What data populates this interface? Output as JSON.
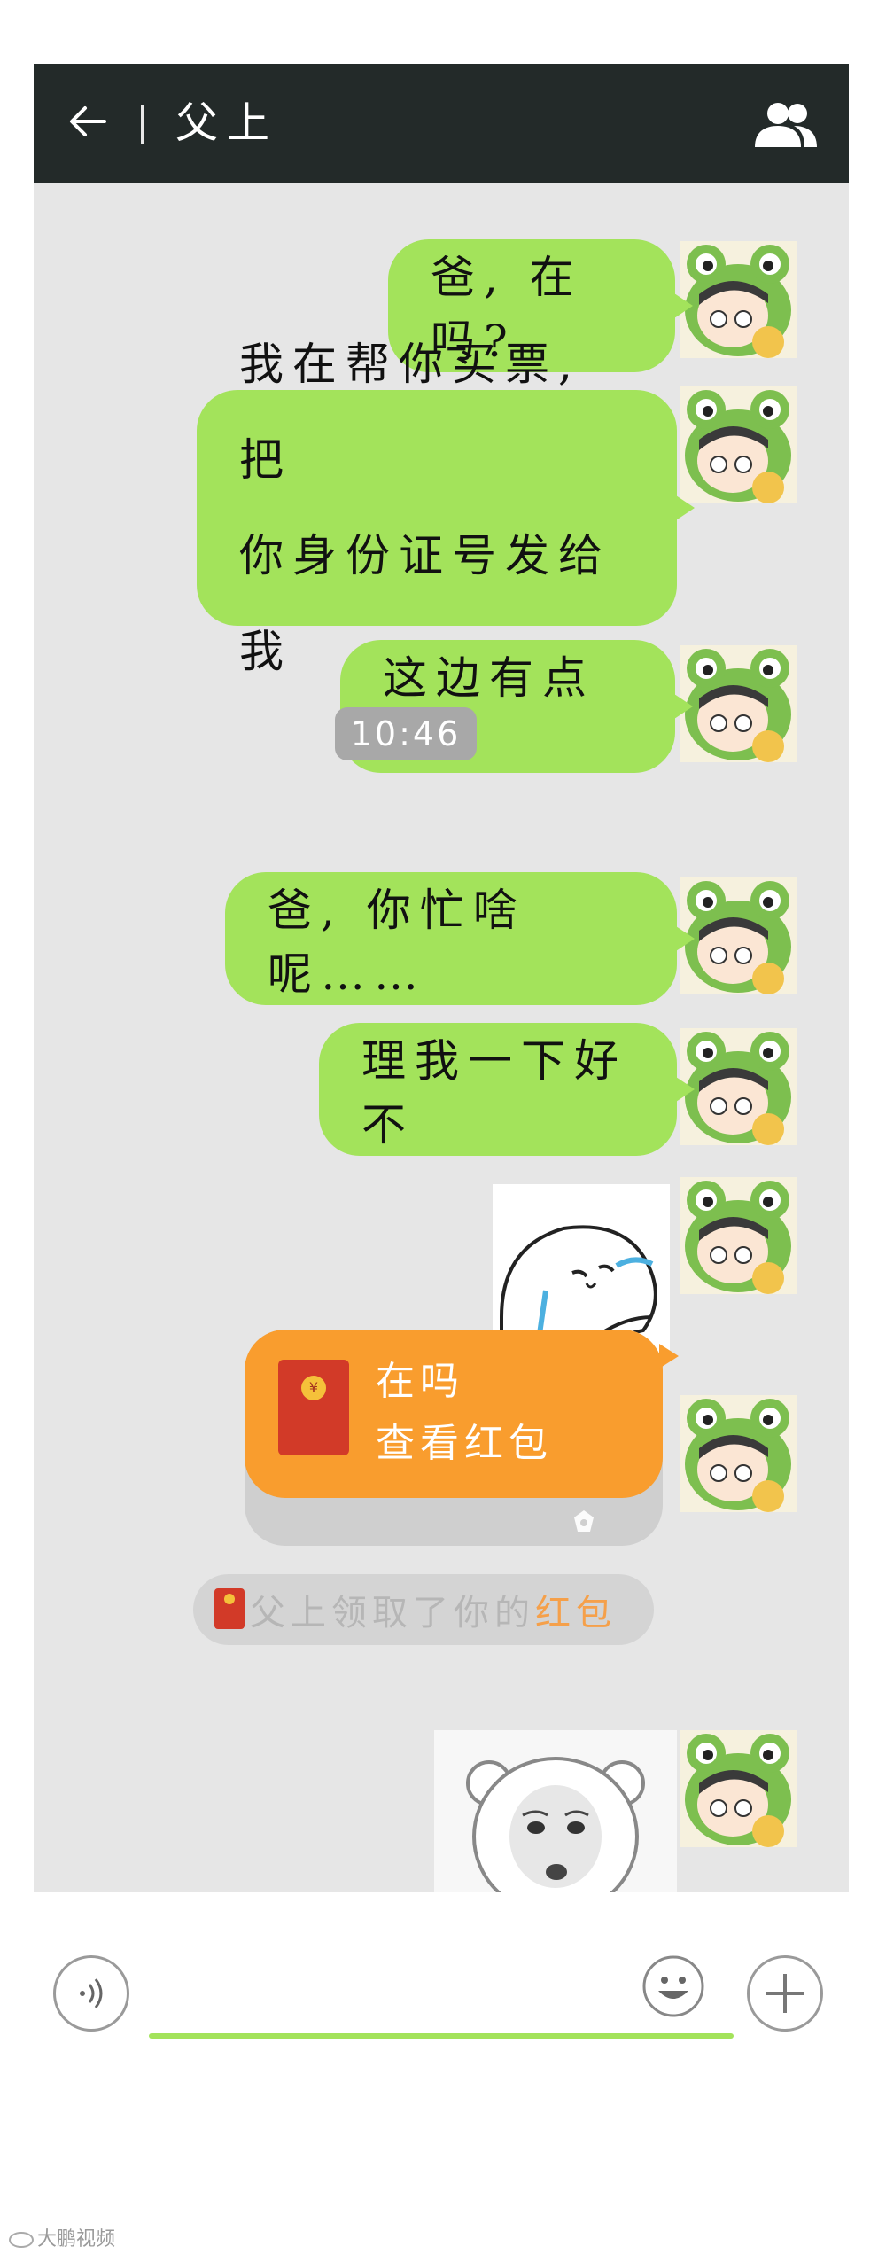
{
  "header": {
    "title": "父上",
    "back_icon": "arrow-left-icon",
    "contacts_icon": "group-icon"
  },
  "messages": [
    {
      "type": "text",
      "lines": [
        "爸, 在吗?"
      ]
    },
    {
      "type": "text",
      "lines": [
        "我在帮你买票, 把",
        "你身份证号发给我"
      ]
    },
    {
      "type": "text",
      "lines": [
        "这边有点急"
      ]
    },
    {
      "type": "time",
      "text": "10:46"
    },
    {
      "type": "text",
      "lines": [
        "爸, 你忙啥呢……"
      ]
    },
    {
      "type": "text",
      "lines": [
        "理我一下好不"
      ]
    },
    {
      "type": "sticker",
      "description": "crying-bun-sticker"
    },
    {
      "type": "red_packet",
      "title": "在吗",
      "subtitle": "查看红包"
    },
    {
      "type": "notice",
      "prefix": "父上领取了你的",
      "highlight": "红包"
    },
    {
      "type": "sticker",
      "description": "shocked-bear-sticker"
    }
  ],
  "input": {
    "voice_icon": "voice-icon",
    "emoji_icon": "emoji-icon",
    "plus_icon": "plus-icon"
  },
  "watermark": "大鹏视频",
  "colors": {
    "header": "#232a29",
    "bubble": "#a3e35b",
    "packet": "#f99d2e",
    "packet_envelope": "#d23a28",
    "chat_bg": "#e6e6e6"
  }
}
